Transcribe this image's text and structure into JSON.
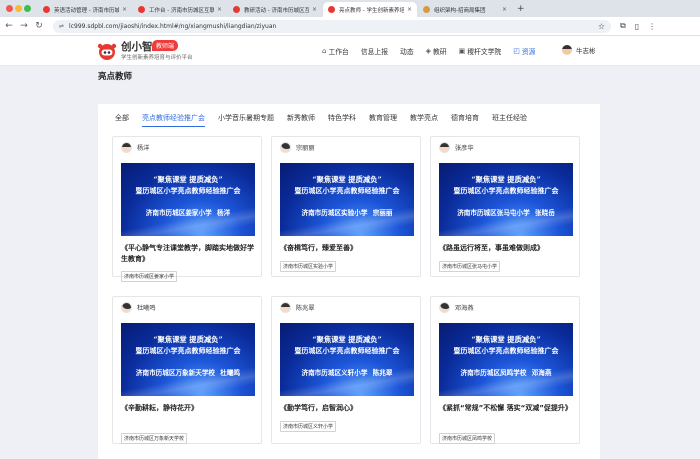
{
  "browser": {
    "tabs": [
      {
        "title": "英语活动管理 - 济南市历城区二...",
        "favicon_color": "#e53935",
        "active": false
      },
      {
        "title": "工作台 - 济南市历城区互联互动...",
        "favicon_color": "#e53935",
        "active": false
      },
      {
        "title": "教研活动 - 济南市历城区互联互...",
        "favicon_color": "#e53935",
        "active": false
      },
      {
        "title": "亮点教师 - 学生创新素养培育与...",
        "favicon_color": "#e53935",
        "active": true
      },
      {
        "title": "组织架构-招商局集团",
        "favicon_color": "#d99a3a",
        "active": false
      }
    ],
    "url": "lc999.sdpbl.com/jiaoshi/index.html#/ng/xiangmushi/liangdian/ziyuan",
    "new_tab": "+",
    "close_glyph": "×",
    "back_icon": "←",
    "forward_icon": "→",
    "reload_icon": "↻",
    "lock_icon": "⇌",
    "star_icon": "☆",
    "toolbar_icons": [
      "⧉",
      "▯",
      "⋮"
    ]
  },
  "header": {
    "brand": "创小智",
    "badge": "教师端",
    "slogan": "学生创新素养培育与评价平台",
    "menu": [
      {
        "label": "工作台",
        "icon": "⌂",
        "active": false
      },
      {
        "label": "信息上报",
        "icon": "",
        "active": false
      },
      {
        "label": "动态",
        "icon": "",
        "active": false
      },
      {
        "label": "教研",
        "icon": "◈",
        "active": false
      },
      {
        "label": "稷杆文学院",
        "icon": "▣",
        "active": false
      },
      {
        "label": "资源",
        "icon": "◰",
        "active": true
      }
    ],
    "user": "牛志彬"
  },
  "page_title": "亮点教师",
  "categories": [
    {
      "label": "全部",
      "active": false
    },
    {
      "label": "亮点教师经验推广会",
      "active": true
    },
    {
      "label": "小学音乐暑期专题",
      "active": false
    },
    {
      "label": "新秀教师",
      "active": false
    },
    {
      "label": "特色学科",
      "active": false
    },
    {
      "label": "教育管理",
      "active": false
    },
    {
      "label": "教学亮点",
      "active": false
    },
    {
      "label": "德育培育",
      "active": false
    },
    {
      "label": "班主任经验",
      "active": false
    }
  ],
  "banner_common": {
    "line1": "“聚焦课堂 提质减负”",
    "line2": "暨历城区小学亮点教师经验推广会"
  },
  "cards": [
    {
      "name": "杨洋",
      "banner_line3": "济南市历城区姜家小学  杨洋",
      "title": "《平心静气专注课堂教学，脚踏实地做好学生教育》",
      "school": "济南市历城区姜家小学"
    },
    {
      "name": "宗丽丽",
      "banner_line3": "济南市历城区实验小学  宗丽丽",
      "title": "《奋楫笃行，臻爱至善》",
      "school": "济南市历城区实验小学"
    },
    {
      "name": "张彦华",
      "banner_line3": "济南市历城区张马屯小学  张晓岳",
      "title": "《路虽远行将至，事虽难做则成》",
      "school": "济南市历城区张马屯小学"
    },
    {
      "name": "杜曦鸣",
      "banner_line3": "济南市历城区万象新天学校  杜曦鸣",
      "title": "《辛勤耕耘，静待花开》",
      "school": "济南市历城区万象新天学校"
    },
    {
      "name": "陈兆翠",
      "banner_line3": "济南市历城区义轩小学  陈兆翠",
      "title": "《勤学笃行，启智润心》",
      "school": "济南市历城区义轩小学"
    },
    {
      "name": "邓海燕",
      "banner_line3": "济南市历城区凤鸣学校  邓海燕",
      "title": "《紧抓“常规”不松懈 落实“双减”促提升》",
      "school": "济南市历城区凤鸣学校"
    }
  ]
}
